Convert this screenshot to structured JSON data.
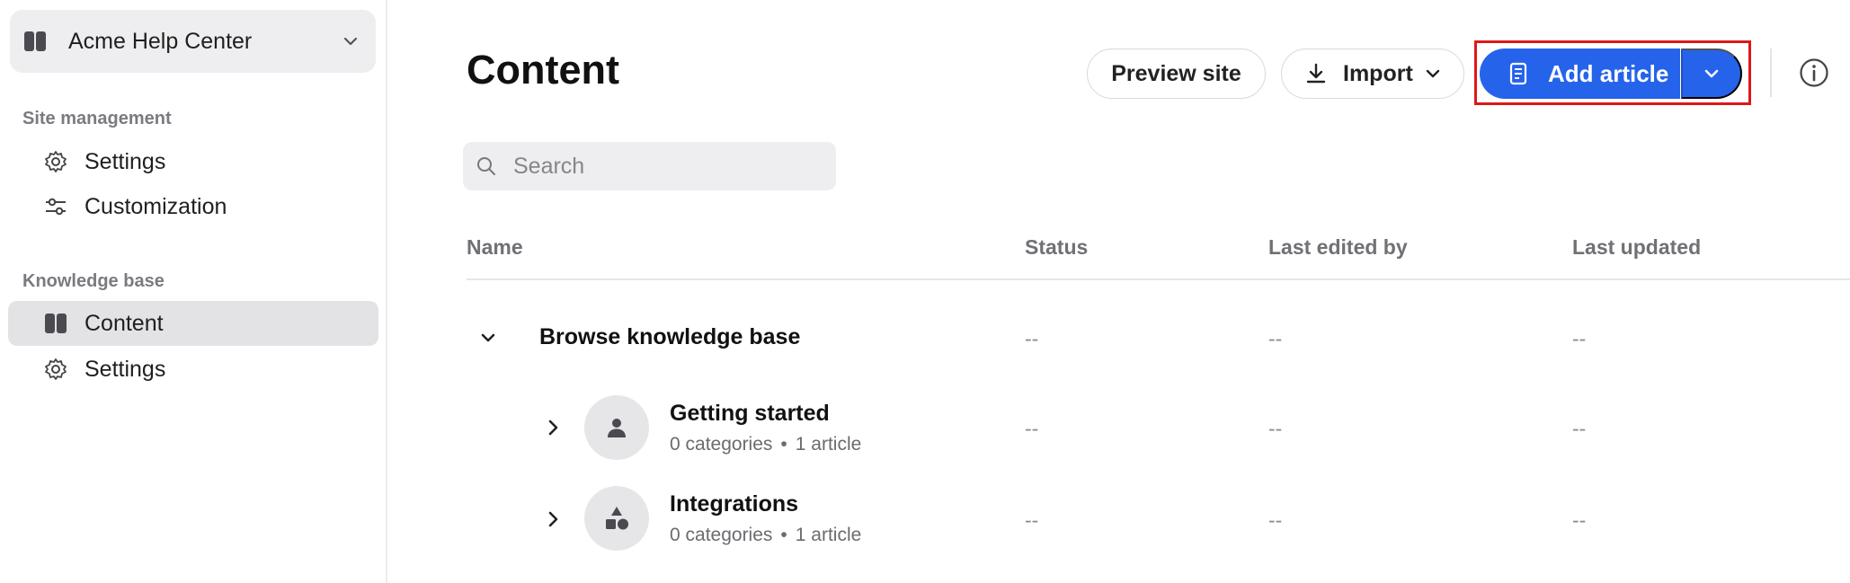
{
  "sidebar": {
    "workspace": {
      "name": "Acme Help Center",
      "icon": "book-open-icon"
    },
    "sections": [
      {
        "title": "Site management",
        "items": [
          {
            "label": "Settings",
            "icon": "gear-icon"
          },
          {
            "label": "Customization",
            "icon": "sliders-icon"
          }
        ]
      },
      {
        "title": "Knowledge base",
        "items": [
          {
            "label": "Content",
            "icon": "book-open-icon",
            "active": true
          },
          {
            "label": "Settings",
            "icon": "gear-icon"
          }
        ]
      }
    ]
  },
  "header": {
    "title": "Content",
    "preview_label": "Preview site",
    "import_label": "Import",
    "add_label": "Add article"
  },
  "search": {
    "placeholder": "Search",
    "value": ""
  },
  "table": {
    "columns": [
      "Name",
      "Status",
      "Last edited by",
      "Last updated"
    ],
    "empty_value": "--",
    "group": {
      "name": "Browse knowledge base",
      "status": "--",
      "edited_by": "--",
      "updated": "--"
    },
    "rows": [
      {
        "name": "Getting started",
        "categories": "0 categories",
        "articles": "1 article",
        "status": "--",
        "edited_by": "--",
        "updated": "--",
        "icon": "person-icon"
      },
      {
        "name": "Integrations",
        "categories": "0 categories",
        "articles": "1 article",
        "status": "--",
        "edited_by": "--",
        "updated": "--",
        "icon": "shapes-icon"
      }
    ]
  },
  "colors": {
    "primary": "#2563eb",
    "highlight": "#e01717",
    "active_nav": "#e3e3e6"
  }
}
